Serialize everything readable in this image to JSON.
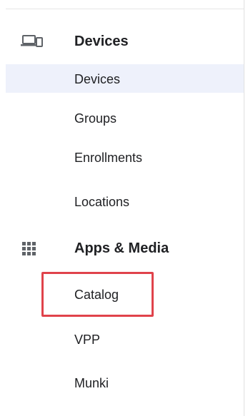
{
  "sidebar": {
    "sections": [
      {
        "icon": "devices-icon",
        "label": "Devices",
        "items": [
          {
            "label": "Devices",
            "selected": true
          },
          {
            "label": "Groups",
            "selected": false
          },
          {
            "label": "Enrollments",
            "selected": false
          },
          {
            "label": "Locations",
            "selected": false
          }
        ]
      },
      {
        "icon": "apps-grid-icon",
        "label": "Apps & Media",
        "items": [
          {
            "label": "Catalog",
            "selected": false,
            "highlighted": true
          },
          {
            "label": "VPP",
            "selected": false
          },
          {
            "label": "Munki",
            "selected": false
          }
        ]
      }
    ]
  },
  "colors": {
    "selected_background": "#eef1fb",
    "highlight_border": "#e0434b",
    "text": "#202124",
    "icon": "#5f6368"
  }
}
